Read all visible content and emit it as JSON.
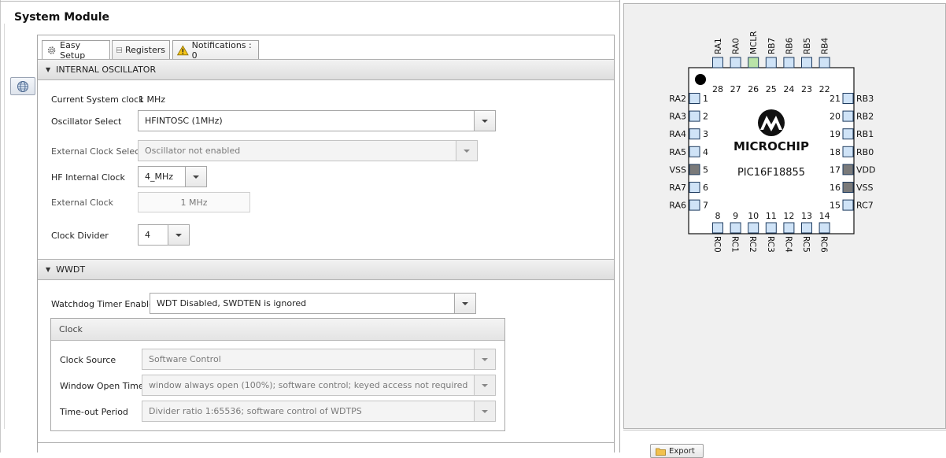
{
  "module": {
    "title": "System Module"
  },
  "tabs": {
    "easy_setup": "Easy Setup",
    "registers": "Registers",
    "notifications": "Notifications : 0"
  },
  "oscillator": {
    "header": "INTERNAL OSCILLATOR",
    "current_clock_label": "Current System clock",
    "current_clock_value": "1 MHz",
    "osc_select_label": "Oscillator Select",
    "osc_select_value": "HFINTOSC (1MHz)",
    "ext_clock_select_label": "External Clock Select",
    "ext_clock_select_value": "Oscillator not enabled",
    "hf_internal_clock_label": "HF Internal Clock",
    "hf_internal_clock_value": "4_MHz",
    "external_clock_label": "External Clock",
    "external_clock_value": "1 MHz",
    "clock_divider_label": "Clock Divider",
    "clock_divider_value": "4"
  },
  "wwdt": {
    "header": "WWDT",
    "wdt_enable_label": "Watchdog Timer Enable",
    "wdt_enable_value": "WDT Disabled, SWDTEN is ignored",
    "clock_group": {
      "title": "Clock",
      "clock_source_label": "Clock Source",
      "clock_source_value": "Software Control",
      "window_open_label": "Window Open Time",
      "window_open_value": "window always open (100%); software control; keyed access not required",
      "timeout_label": "Time-out Period",
      "timeout_value": "Divider ratio 1:65536; software control of WDTPS"
    }
  },
  "chip": {
    "logo_text": "MICROCHIP",
    "part_number": "PIC16F18855",
    "top_pins": [
      {
        "name": "RA1",
        "num": "28",
        "type": "io"
      },
      {
        "name": "RA0",
        "num": "27",
        "type": "io"
      },
      {
        "name": "MCLR",
        "num": "26",
        "type": "mclr"
      },
      {
        "name": "RB7",
        "num": "25",
        "type": "io"
      },
      {
        "name": "RB6",
        "num": "24",
        "type": "io"
      },
      {
        "name": "RB5",
        "num": "23",
        "type": "io"
      },
      {
        "name": "RB4",
        "num": "22",
        "type": "io"
      }
    ],
    "left_pins": [
      {
        "name": "RA2",
        "num": "1",
        "type": "io"
      },
      {
        "name": "RA3",
        "num": "2",
        "type": "io"
      },
      {
        "name": "RA4",
        "num": "3",
        "type": "io"
      },
      {
        "name": "RA5",
        "num": "4",
        "type": "io"
      },
      {
        "name": "VSS",
        "num": "5",
        "type": "power"
      },
      {
        "name": "RA7",
        "num": "6",
        "type": "io"
      },
      {
        "name": "RA6",
        "num": "7",
        "type": "io"
      }
    ],
    "right_pins": [
      {
        "name": "RB3",
        "num": "21",
        "type": "io"
      },
      {
        "name": "RB2",
        "num": "20",
        "type": "io"
      },
      {
        "name": "RB1",
        "num": "19",
        "type": "io"
      },
      {
        "name": "RB0",
        "num": "18",
        "type": "io"
      },
      {
        "name": "VDD",
        "num": "17",
        "type": "power"
      },
      {
        "name": "VSS",
        "num": "16",
        "type": "power"
      },
      {
        "name": "RC7",
        "num": "15",
        "type": "io"
      }
    ],
    "bottom_pins": [
      {
        "name": "RC0",
        "num": "8",
        "type": "io"
      },
      {
        "name": "RC1",
        "num": "9",
        "type": "io"
      },
      {
        "name": "RC2",
        "num": "10",
        "type": "io"
      },
      {
        "name": "RC3",
        "num": "11",
        "type": "io"
      },
      {
        "name": "RC4",
        "num": "12",
        "type": "io"
      },
      {
        "name": "RC5",
        "num": "13",
        "type": "io"
      },
      {
        "name": "RC6",
        "num": "14",
        "type": "io"
      }
    ],
    "colors": {
      "io": "#cfe3f7",
      "mclr": "#b9e3a8",
      "power": "#7a7a7a",
      "border": "#1f3c60"
    }
  },
  "export": {
    "label": "Export"
  }
}
